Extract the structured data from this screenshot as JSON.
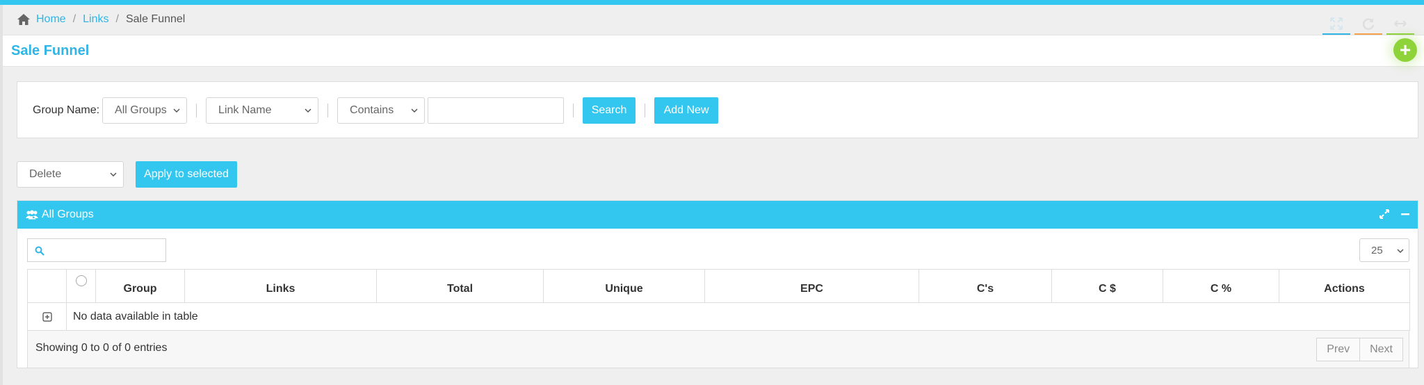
{
  "breadcrumb": {
    "home": "Home",
    "links": "Links",
    "current": "Sale Funnel",
    "sep1": "/",
    "sep2": "/"
  },
  "page": {
    "title": "Sale Funnel",
    "add_icon": "+"
  },
  "filters": {
    "group_label": "Group Name:",
    "group_value": "All Groups",
    "field_value": "Link Name",
    "operator_value": "Contains",
    "query_value": "",
    "search_label": "Search",
    "add_new_label": "Add New"
  },
  "bulk": {
    "action_value": "Delete",
    "apply_label": "Apply to selected"
  },
  "panel": {
    "title": "All Groups",
    "page_length": "25",
    "search_value": ""
  },
  "table": {
    "columns": [
      "Group",
      "Links",
      "Total",
      "Unique",
      "EPC",
      "C's",
      "C $",
      "C %",
      "Actions"
    ],
    "empty_message": "No data available in table",
    "info": "Showing 0 to 0 of 0 entries",
    "prev": "Prev",
    "next": "Next"
  },
  "colors": {
    "accent": "#33c7f0",
    "link": "#2fb5e6",
    "add_button": "#8fd33a"
  },
  "icons": {
    "home": "home-icon",
    "fullscreen": "fullscreen-icon",
    "refresh": "refresh-icon",
    "collapse": "collapse-icon",
    "add": "plus-icon",
    "users": "users-icon",
    "expand_panel": "expand-icon",
    "minimize_panel": "minus-icon",
    "search": "search-icon",
    "row_expand": "plus-square-icon"
  }
}
